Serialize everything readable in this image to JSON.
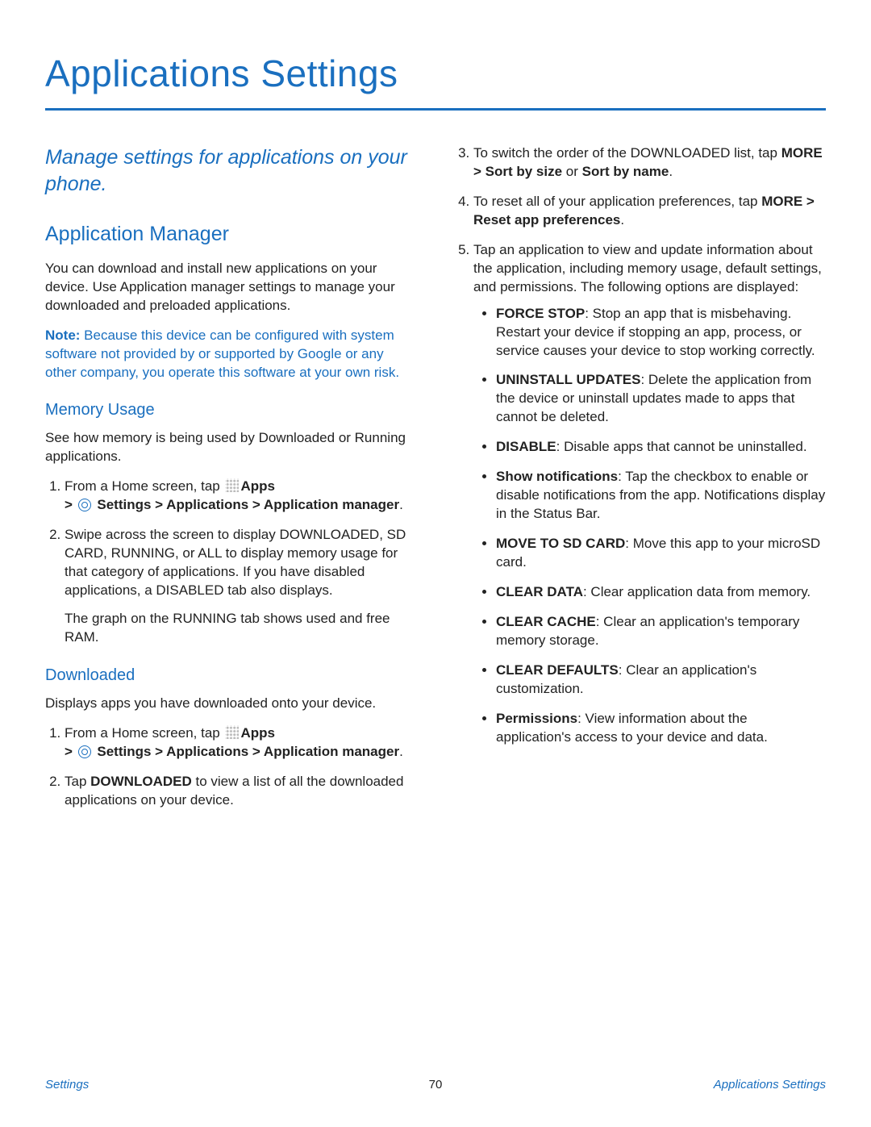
{
  "title": "Applications Settings",
  "subtitle": "Manage settings for applications on your phone.",
  "h_app_manager": "Application Manager",
  "p_app_manager": "You can download and install new applications on your device. Use Application manager settings to manage your downloaded and preloaded applications.",
  "note_label": "Note:",
  "note_body": " Because this device can be configured with system software not provided by or supported by Google or any other company, you operate this software at your own risk.",
  "h_memory": "Memory Usage",
  "p_memory": "See how memory is being used by Downloaded or Running applications.",
  "step_home_prefix": "From a Home screen, tap ",
  "apps_label": "Apps",
  "nav_chain": " Settings > Applications > Application manager",
  "period": ".",
  "mem_step2": "Swipe across the screen to display DOWNLOADED, SD CARD, RUNNING, or ALL to display memory usage for that category of applications. If you have disabled applications, a DISABLED tab also displays.",
  "mem_step2b": "The graph on the RUNNING tab shows used and free RAM.",
  "h_downloaded": "Downloaded",
  "p_downloaded": "Displays apps you have downloaded onto your device.",
  "dl_step2a": "Tap ",
  "dl_step2b": "DOWNLOADED",
  "dl_step2c": " to view a list of all the downloaded applications on your device.",
  "right": {
    "step3a": "To switch the order of the DOWNLOADED list, tap ",
    "step3b": "MORE > Sort by size",
    "step3c": " or ",
    "step3d": "Sort by name",
    "step4a": "To reset all of your application preferences, tap ",
    "step4b": "MORE > Reset app preferences",
    "step5": "Tap an application to view and update information about the application, including memory usage, default settings, and permissions. The following options are displayed:",
    "bullets": [
      {
        "b": "FORCE STOP",
        "t": ": Stop an app that is misbehaving. Restart your device if stopping an app, process, or service causes your device to stop working correctly."
      },
      {
        "b": "UNINSTALL UPDATES",
        "t": ": Delete the application from the device or uninstall updates made to apps that cannot be deleted."
      },
      {
        "b": "DISABLE",
        "t": ": Disable apps that cannot be uninstalled."
      },
      {
        "b": "Show notifications",
        "t": ": Tap the checkbox to enable or disable notifications from the app. Notifications display in the Status Bar."
      },
      {
        "b": "MOVE TO SD CARD",
        "t": ": Move this app to your microSD card."
      },
      {
        "b": "CLEAR DATA",
        "t": ": Clear application data from memory."
      },
      {
        "b": "CLEAR CACHE",
        "t": ": Clear an application's temporary memory storage."
      },
      {
        "b": "CLEAR DEFAULTS",
        "t": ": Clear an application's customization."
      },
      {
        "b": "Permissions",
        "t": ": View information about the application's access to your device and data."
      }
    ]
  },
  "footer": {
    "left": "Settings",
    "center": "70",
    "right": "Applications Settings"
  },
  "gt": "> "
}
